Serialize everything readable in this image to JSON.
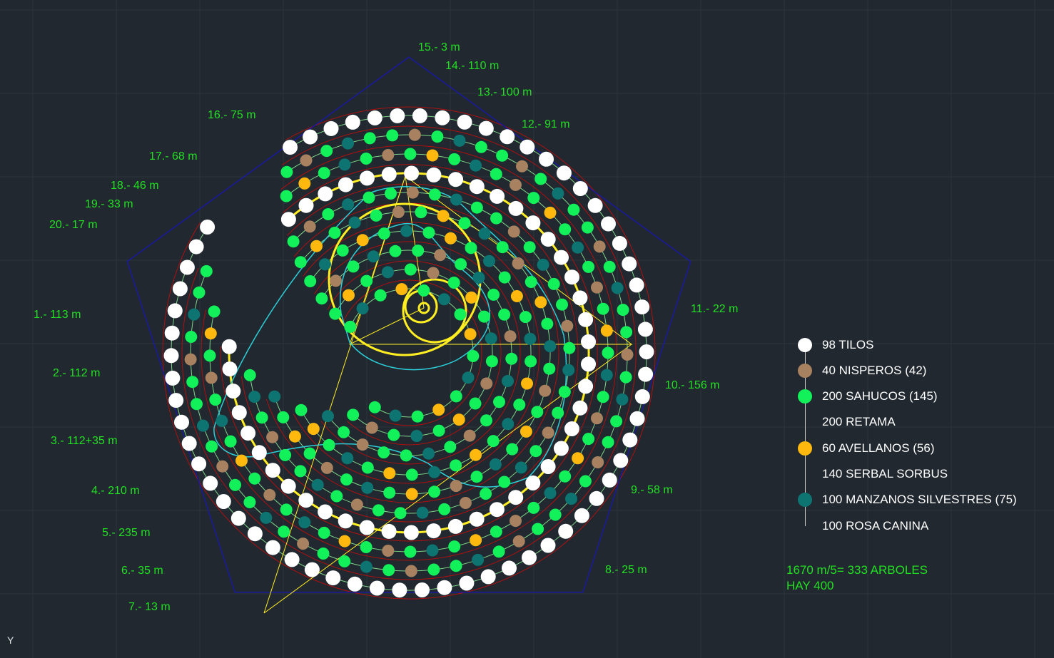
{
  "colors": {
    "background": "#212830",
    "grid": "#2b333c",
    "tilos": "#ffffff",
    "nisperos": "#a88160",
    "sahucos": "#12f05a",
    "avellanos": "#ffb80e",
    "manzanos": "#0d7472",
    "row_arc": "#b01010",
    "connector": "#7fd68a",
    "outline": "#1a1aa0",
    "spiral": "#ffee22",
    "cyan": "#2ccfd8",
    "label": "#22e022"
  },
  "row_labels": [
    "1.- 113 m",
    "2.- 112 m",
    "3.- 112+35 m",
    "4.- 210 m",
    "5.- 235 m",
    "6.- 35 m",
    "7.- 13 m",
    "8.- 25 m",
    "9.- 58 m",
    "10.- 156 m",
    "11.- 22 m",
    "12.- 91 m",
    "13.- 100 m",
    "14.- 110 m",
    "15.- 3 m",
    "16.- 75 m",
    "17.- 68 m",
    "18.- 46 m",
    "19.- 33 m",
    "20.- 17 m"
  ],
  "legend": [
    {
      "label": "98 TILOS",
      "color": "#ffffff",
      "icon": "white-circle"
    },
    {
      "label": "40 NISPEROS (42)",
      "color": "#a88160",
      "icon": "brown-circle"
    },
    {
      "label": "200 SAHUCOS (145)",
      "color": "#12f05a",
      "icon": "green-circle"
    },
    {
      "label": "200 RETAMA",
      "color": "none",
      "icon": "none"
    },
    {
      "label": "60 AVELLANOS (56)",
      "color": "#ffb80e",
      "icon": "orange-circle"
    },
    {
      "label": "140 SERBAL SORBUS",
      "color": "none",
      "icon": "none"
    },
    {
      "label": "100 MANZANOS SILVESTRES (75)",
      "color": "#0d7472",
      "icon": "teal-circle"
    },
    {
      "label": "100 ROSA CANINA",
      "color": "none",
      "icon": "none"
    }
  ],
  "notes": {
    "line1": "1670 m/5= 333 ARBOLES",
    "line2": "HAY 400"
  },
  "ucs_label": "Y"
}
